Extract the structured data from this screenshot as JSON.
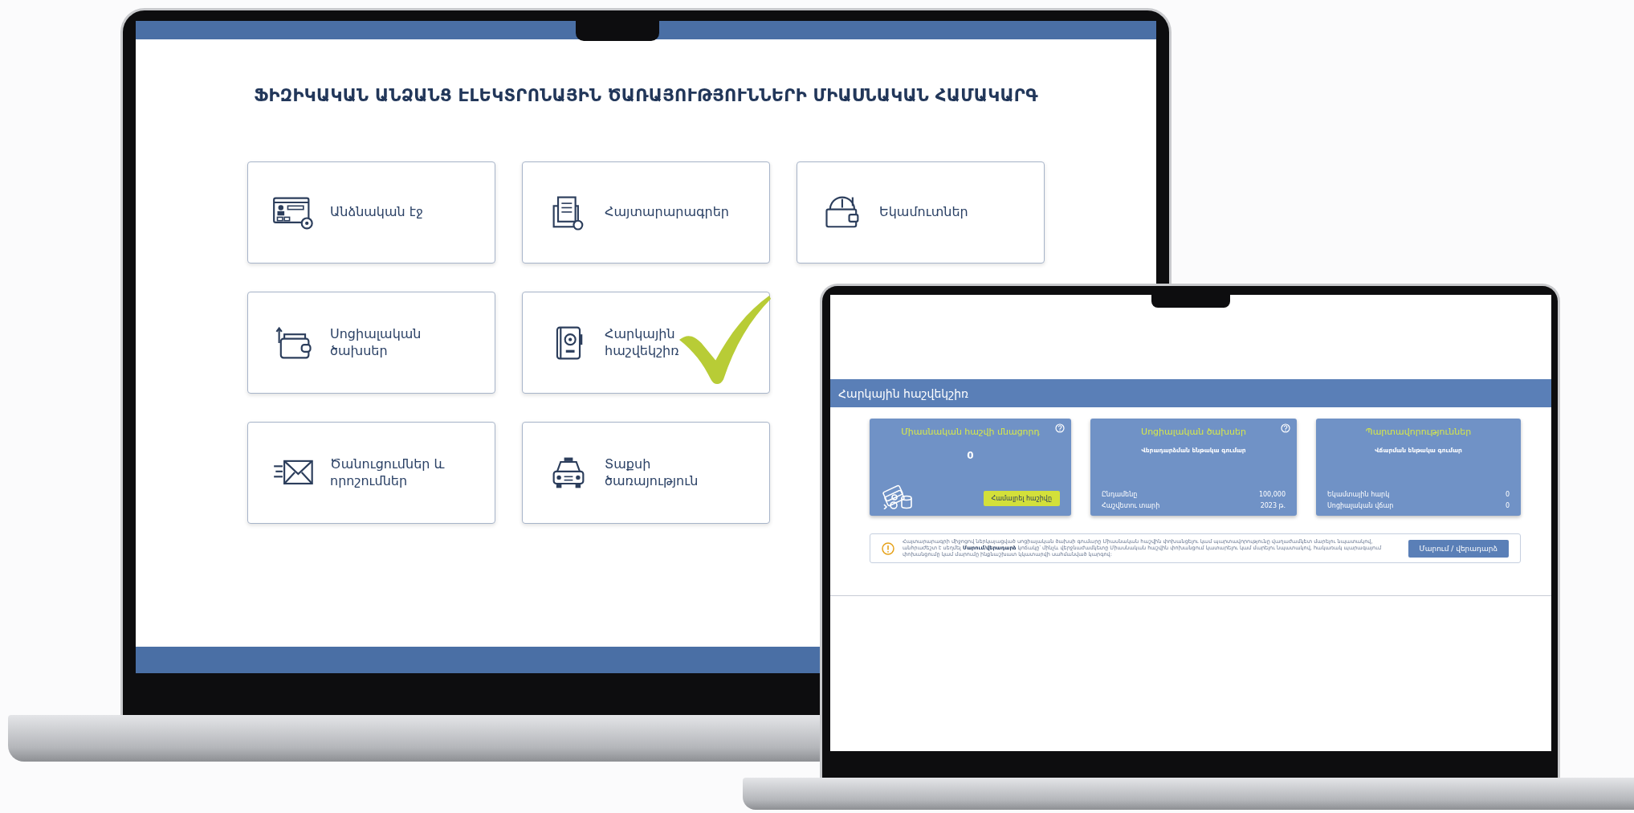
{
  "laptop_main": {
    "title": "ՖԻԶԻԿԱԿԱՆ ԱՆՁԱՆՑ ԷԼԵԿՏՐՈՆԱՅԻՆ ԾԱՌԱՅՈՒԹՅՈՒՆՆԵՐԻ ՄԻԱՍՆԱԿԱՆ ՀԱՄԱԿԱՐԳ",
    "tile_rows": [
      [
        {
          "label": "Անձնական էջ",
          "kind": "profile"
        },
        {
          "label": "Հայտարարագրեր",
          "kind": "documents"
        },
        {
          "label": "Եկամուտներ",
          "kind": "income"
        }
      ],
      [
        {
          "label": "Սոցիալական ծախսեր",
          "kind": "wallet"
        },
        {
          "label": "Հարկային հաշվեկշիռ",
          "kind": "ledger"
        }
      ],
      [
        {
          "label": "Ծանուցումներ և որոշումներ",
          "kind": "mail"
        },
        {
          "label": "Տաքսի ծառայություն",
          "kind": "taxi"
        }
      ]
    ]
  },
  "laptop_secondary": {
    "header": "Հարկային հաշվեկշիռ",
    "cards": [
      {
        "kind": "balance",
        "title": "Միասնական հաշվի մնացորդ",
        "help": true,
        "amount": "0",
        "button": "Համալրել հաշիվը"
      },
      {
        "kind": "table",
        "title": "Սոցիալական ծախսեր",
        "help": true,
        "subtitle": "Վերադարձման ենթակա գումար",
        "rows": [
          {
            "label": "Ընդամենը",
            "value": "100,000"
          },
          {
            "label": "Հաշվետու տարի",
            "value": "2023 թ."
          }
        ]
      },
      {
        "kind": "table",
        "title": "Պարտավորություններ",
        "help": false,
        "subtitle": "Վճարման ենթակա գումար",
        "rows": [
          {
            "label": "Եկամտային հարկ",
            "value": "0"
          },
          {
            "label": "Սոցիալական վճար",
            "value": "0"
          }
        ]
      }
    ],
    "notice": {
      "text": "Հայտարարագրի միջոցով ներկայացված սոցիալական ծախսի գումարը Միասնական հաշվին փոխանցելու կամ պարտավորությունը վաղաժամկետ մարելու նպատակով, անհրաժեշտ է սեղմել **Մարում/վերադարձ** կոճակը՝ մինչև վերջնաժամկետը Միասնական հաշվին փոխանցում կատարելու կամ մարելու նպատակով, հակառակ պարագայում փոխանցումը կամ մարումը ինքնաշխատ կկատարվի սահմանված կարգով:",
      "button": "Մարում / վերադարձ"
    }
  }
}
